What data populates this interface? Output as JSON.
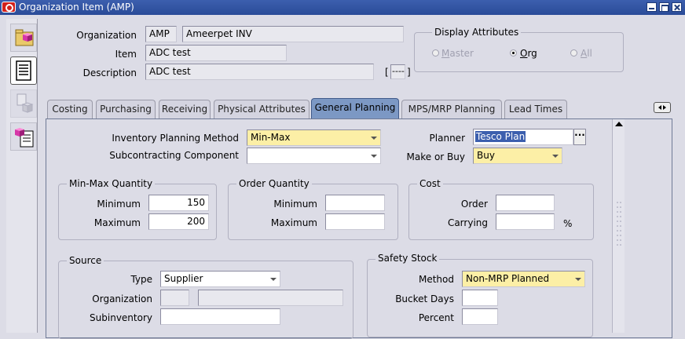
{
  "window": {
    "title": "Organization Item (AMP)"
  },
  "header": {
    "organization_label": "Organization",
    "organization_code": "AMP",
    "organization_name": "Ameerpet INV",
    "item_label": "Item",
    "item_value": "ADC test",
    "description_label": "Description",
    "description_value": "ADC test",
    "descflex_open": "[",
    "descflex_value": "----",
    "descflex_close": "]"
  },
  "display_attributes": {
    "title": "Display Attributes",
    "options": [
      "Master",
      "Org",
      "All"
    ],
    "selected": "Org"
  },
  "tabs": [
    "Costing",
    "Purchasing",
    "Receiving",
    "Physical Attributes",
    "General Planning",
    "MPS/MRP Planning",
    "Lead Times"
  ],
  "active_tab": "General Planning",
  "planning": {
    "inv_method_label": "Inventory Planning Method",
    "inv_method_value": "Min-Max",
    "subcontract_label": "Subcontracting Component",
    "subcontract_value": "",
    "planner_label": "Planner",
    "planner_value": "Tesco Plan",
    "make_buy_label": "Make or Buy",
    "make_buy_value": "Buy"
  },
  "minmax": {
    "title": "Min-Max Quantity",
    "minimum_label": "Minimum",
    "minimum_value": "150",
    "maximum_label": "Maximum",
    "maximum_value": "200"
  },
  "order_qty": {
    "title": "Order Quantity",
    "minimum_label": "Minimum",
    "minimum_value": "",
    "maximum_label": "Maximum",
    "maximum_value": ""
  },
  "cost": {
    "title": "Cost",
    "order_label": "Order",
    "order_value": "",
    "carrying_label": "Carrying",
    "carrying_value": "",
    "percent_sign": "%"
  },
  "source": {
    "title": "Source",
    "type_label": "Type",
    "type_value": "Supplier",
    "org_label": "Organization",
    "org_code": "",
    "org_name": "",
    "subinv_label": "Subinventory",
    "subinv_value": ""
  },
  "safety_stock": {
    "title": "Safety Stock",
    "method_label": "Method",
    "method_value": "Non-MRP Planned",
    "bucket_label": "Bucket Days",
    "bucket_value": "",
    "percent_label": "Percent",
    "percent_value": ""
  },
  "colors": {
    "title_bar": "#2f50a0",
    "active_tab": "#7c98c4",
    "required_field": "#fcefa6",
    "background": "#dcdce6"
  },
  "icons": {
    "window_icon": "oracle-icon",
    "left_toolbar": [
      "folder-cube-icon",
      "list-icon",
      "doc-cube-icon",
      "cube-list-icon"
    ]
  }
}
